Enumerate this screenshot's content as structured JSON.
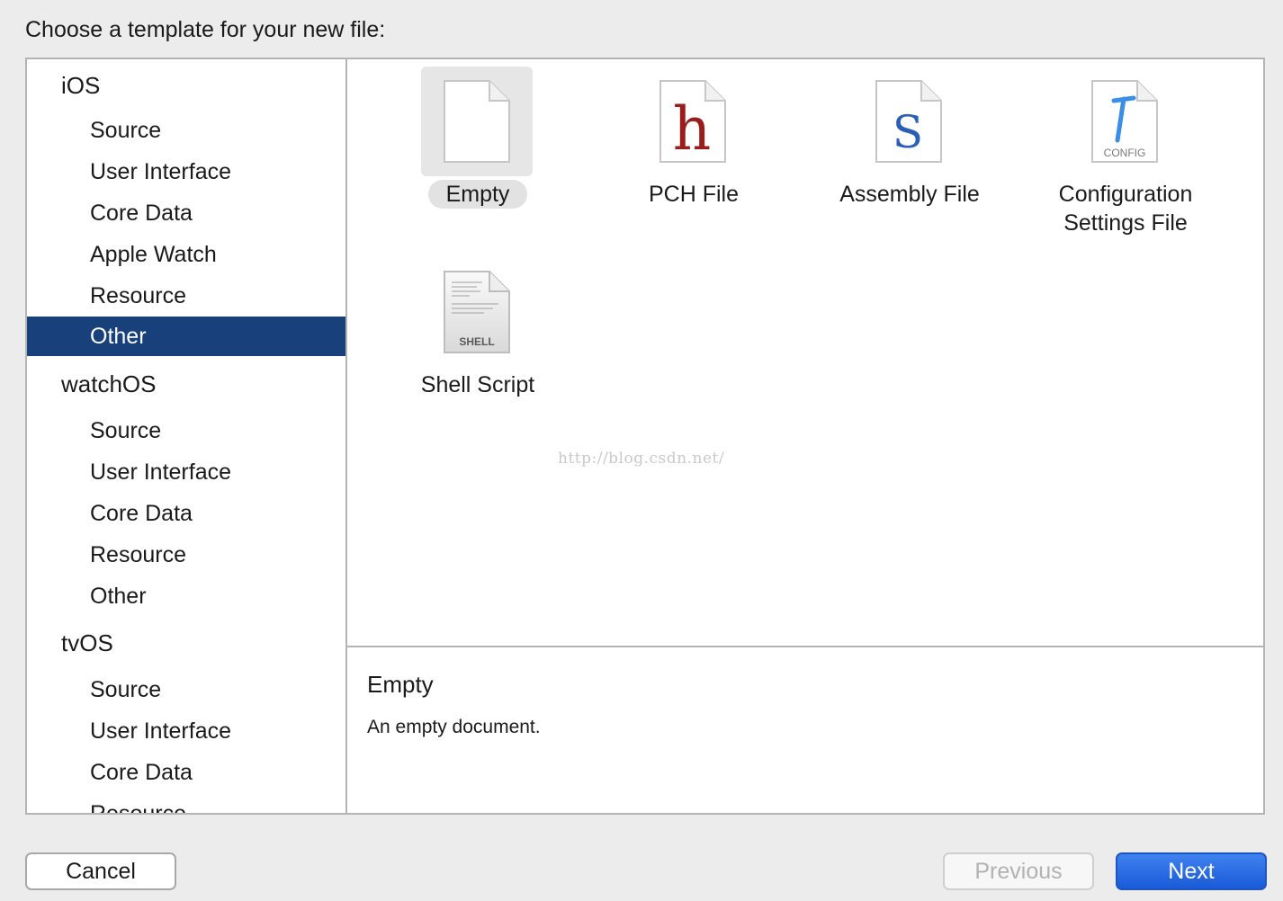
{
  "dialog": {
    "title": "Choose a template for your new file:"
  },
  "sidebar": {
    "groups": [
      {
        "title": "iOS",
        "items": [
          "Source",
          "User Interface",
          "Core Data",
          "Apple Watch",
          "Resource",
          "Other"
        ]
      },
      {
        "title": "watchOS",
        "items": [
          "Source",
          "User Interface",
          "Core Data",
          "Resource",
          "Other"
        ]
      },
      {
        "title": "tvOS",
        "items": [
          "Source",
          "User Interface",
          "Core Data",
          "Resource"
        ]
      }
    ],
    "selected_item": "iOS / Other"
  },
  "templates": [
    {
      "label": "Empty",
      "icon": "empty-document-icon",
      "selected": true
    },
    {
      "label": "PCH File",
      "icon": "pch-file-icon",
      "glyph": "h"
    },
    {
      "label": "Assembly File",
      "icon": "assembly-file-icon",
      "glyph": "S"
    },
    {
      "label_line1": "Configuration",
      "label_line2": "Settings File",
      "icon": "config-file-icon",
      "badge": "CONFIG"
    },
    {
      "label": "Shell Script",
      "icon": "shell-script-icon",
      "badge": "SHELL"
    }
  ],
  "watermark": "http://blog.csdn.net/",
  "description": {
    "title": "Empty",
    "text": "An empty document."
  },
  "buttons": {
    "cancel": "Cancel",
    "previous": "Previous",
    "next": "Next"
  },
  "colors": {
    "selection": "#18417c",
    "accent": "#2a6ee6",
    "pch_glyph": "#9b1c1c",
    "assembly_glyph": "#2a5fb5",
    "config_glyph": "#3a8ee6"
  }
}
